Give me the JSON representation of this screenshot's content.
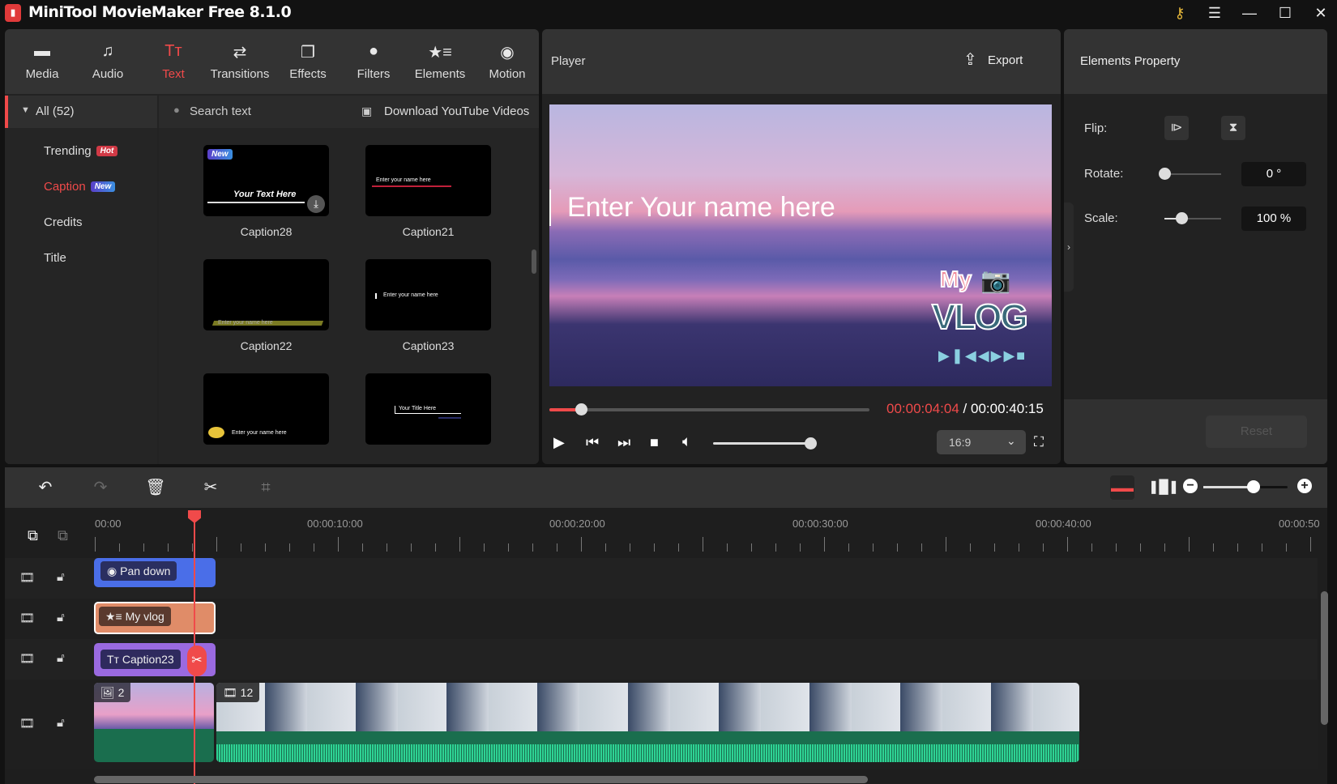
{
  "app": {
    "title": "MiniTool MovieMaker Free 8.1.0",
    "icon": "app-logo-icon"
  },
  "window_controls": {
    "key": "key-icon",
    "menu": "menu-icon",
    "minimize": "minimize-icon",
    "maximize": "maximize-icon",
    "close": "close-icon"
  },
  "media_tabs": [
    {
      "label": "Media",
      "icon": "folder-icon",
      "glyph": "▬"
    },
    {
      "label": "Audio",
      "icon": "music-icon",
      "glyph": "♫"
    },
    {
      "label": "Text",
      "icon": "text-icon",
      "glyph": "Tт",
      "active": true
    },
    {
      "label": "Transitions",
      "icon": "transition-icon",
      "glyph": "⇄"
    },
    {
      "label": "Effects",
      "icon": "effects-icon",
      "glyph": "❐"
    },
    {
      "label": "Filters",
      "icon": "filters-icon",
      "glyph": "●"
    },
    {
      "label": "Elements",
      "icon": "elements-icon",
      "glyph": "★≡"
    },
    {
      "label": "Motion",
      "icon": "motion-icon",
      "glyph": "◉"
    }
  ],
  "categories": {
    "all": "All (52)",
    "items": [
      {
        "label": "Trending",
        "badge": "Hot"
      },
      {
        "label": "Caption",
        "badge": "New",
        "active": true
      },
      {
        "label": "Credits"
      },
      {
        "label": "Title"
      }
    ]
  },
  "search": {
    "placeholder": "Search text",
    "download_youtube": "Download YouTube Videos"
  },
  "templates": [
    {
      "name": "Caption28",
      "preview_text": "Your Text Here",
      "badge": "New"
    },
    {
      "name": "Caption21",
      "preview_text": "Enter your name here"
    },
    {
      "name": "Caption22",
      "preview_text": "Enter your name here"
    },
    {
      "name": "Caption23",
      "preview_text": "Enter your name here"
    },
    {
      "name": "",
      "preview_text": "Enter your name here"
    },
    {
      "name": "",
      "preview_text": "Your Title Here"
    }
  ],
  "player": {
    "title": "Player",
    "export_label": "Export",
    "overlay_text": "Enter Your name here",
    "sticker_text_top": "My",
    "sticker_text_main": "VLOG",
    "current_time": "00:00:04:04",
    "separator": "/",
    "total_time": "00:00:40:15",
    "progress": 0.1,
    "volume": 1.0,
    "aspect_ratio": "16:9"
  },
  "properties": {
    "title": "Elements Property",
    "flip_label": "Flip:",
    "rotate_label": "Rotate:",
    "rotate_value": "0 °",
    "rotate_fraction": 0.0,
    "scale_label": "Scale:",
    "scale_value": "100 %",
    "scale_fraction": 0.3,
    "reset_label": "Reset"
  },
  "timeline": {
    "ruler_labels": [
      "00:00",
      "00:00:10:00",
      "00:00:20:00",
      "00:00:30:00",
      "00:00:40:00",
      "00:00:50"
    ],
    "zoom_fraction": 0.6,
    "clips": {
      "motion": "Pan down",
      "element": "My vlog",
      "text": "Caption23",
      "image_count": "2",
      "video_count": "12"
    },
    "colors": {
      "motion": "#4a6ee8",
      "element": "#e08c68",
      "text": "#9a6ae0",
      "audio": "#1a6e4e",
      "wave": "#2ed394",
      "accent": "#f04a4a"
    }
  }
}
